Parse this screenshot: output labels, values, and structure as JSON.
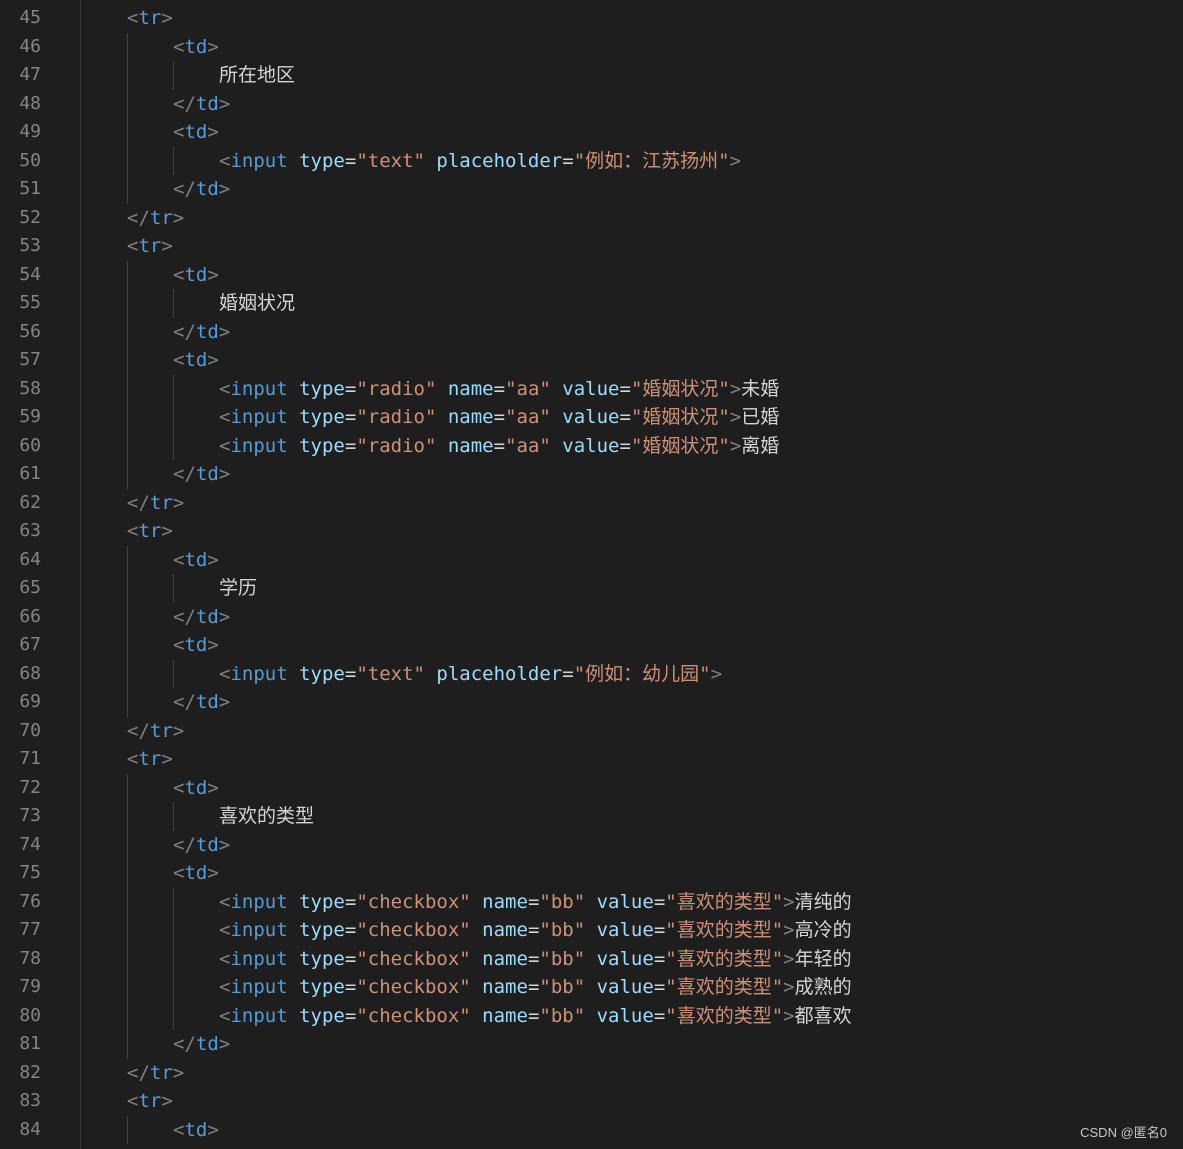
{
  "editor": {
    "lines": [
      {
        "num": "45",
        "indent": 1,
        "tokens": [
          [
            "t-punct",
            "<"
          ],
          [
            "t-tag",
            "tr"
          ],
          [
            "t-punct",
            ">"
          ]
        ]
      },
      {
        "num": "46",
        "indent": 2,
        "tokens": [
          [
            "t-punct",
            "<"
          ],
          [
            "t-tag",
            "td"
          ],
          [
            "t-punct",
            ">"
          ]
        ]
      },
      {
        "num": "47",
        "indent": 3,
        "tokens": [
          [
            "t-text",
            "所在地区"
          ]
        ]
      },
      {
        "num": "48",
        "indent": 2,
        "tokens": [
          [
            "t-punct",
            "</"
          ],
          [
            "t-tag",
            "td"
          ],
          [
            "t-punct",
            ">"
          ]
        ]
      },
      {
        "num": "49",
        "indent": 2,
        "tokens": [
          [
            "t-punct",
            "<"
          ],
          [
            "t-tag",
            "td"
          ],
          [
            "t-punct",
            ">"
          ]
        ]
      },
      {
        "num": "50",
        "indent": 3,
        "tokens": [
          [
            "t-punct",
            "<"
          ],
          [
            "t-tag",
            "input"
          ],
          [
            "t-text",
            " "
          ],
          [
            "t-attr",
            "type"
          ],
          [
            "t-eq",
            "="
          ],
          [
            "t-str",
            "\"text\""
          ],
          [
            "t-text",
            " "
          ],
          [
            "t-attr",
            "placeholder"
          ],
          [
            "t-eq",
            "="
          ],
          [
            "t-str",
            "\"例如：江苏扬州\""
          ],
          [
            "t-punct",
            ">"
          ]
        ]
      },
      {
        "num": "51",
        "indent": 2,
        "tokens": [
          [
            "t-punct",
            "</"
          ],
          [
            "t-tag",
            "td"
          ],
          [
            "t-punct",
            ">"
          ]
        ]
      },
      {
        "num": "52",
        "indent": 1,
        "tokens": [
          [
            "t-punct",
            "</"
          ],
          [
            "t-tag",
            "tr"
          ],
          [
            "t-punct",
            ">"
          ]
        ]
      },
      {
        "num": "53",
        "indent": 1,
        "tokens": [
          [
            "t-punct",
            "<"
          ],
          [
            "t-tag",
            "tr"
          ],
          [
            "t-punct",
            ">"
          ]
        ]
      },
      {
        "num": "54",
        "indent": 2,
        "tokens": [
          [
            "t-punct",
            "<"
          ],
          [
            "t-tag",
            "td"
          ],
          [
            "t-punct",
            ">"
          ]
        ]
      },
      {
        "num": "55",
        "indent": 3,
        "tokens": [
          [
            "t-text",
            "婚姻状况"
          ]
        ]
      },
      {
        "num": "56",
        "indent": 2,
        "tokens": [
          [
            "t-punct",
            "</"
          ],
          [
            "t-tag",
            "td"
          ],
          [
            "t-punct",
            ">"
          ]
        ]
      },
      {
        "num": "57",
        "indent": 2,
        "tokens": [
          [
            "t-punct",
            "<"
          ],
          [
            "t-tag",
            "td"
          ],
          [
            "t-punct",
            ">"
          ]
        ]
      },
      {
        "num": "58",
        "indent": 3,
        "tokens": [
          [
            "t-punct",
            "<"
          ],
          [
            "t-tag",
            "input"
          ],
          [
            "t-text",
            " "
          ],
          [
            "t-attr",
            "type"
          ],
          [
            "t-eq",
            "="
          ],
          [
            "t-str",
            "\"radio\""
          ],
          [
            "t-text",
            " "
          ],
          [
            "t-attr",
            "name"
          ],
          [
            "t-eq",
            "="
          ],
          [
            "t-str",
            "\"aa\""
          ],
          [
            "t-text",
            " "
          ],
          [
            "t-attr",
            "value"
          ],
          [
            "t-eq",
            "="
          ],
          [
            "t-str",
            "\"婚姻状况\""
          ],
          [
            "t-punct",
            ">"
          ],
          [
            "t-text",
            "未婚"
          ]
        ]
      },
      {
        "num": "59",
        "indent": 3,
        "tokens": [
          [
            "t-punct",
            "<"
          ],
          [
            "t-tag",
            "input"
          ],
          [
            "t-text",
            " "
          ],
          [
            "t-attr",
            "type"
          ],
          [
            "t-eq",
            "="
          ],
          [
            "t-str",
            "\"radio\""
          ],
          [
            "t-text",
            " "
          ],
          [
            "t-attr",
            "name"
          ],
          [
            "t-eq",
            "="
          ],
          [
            "t-str",
            "\"aa\""
          ],
          [
            "t-text",
            " "
          ],
          [
            "t-attr",
            "value"
          ],
          [
            "t-eq",
            "="
          ],
          [
            "t-str",
            "\"婚姻状况\""
          ],
          [
            "t-punct",
            ">"
          ],
          [
            "t-text",
            "已婚"
          ]
        ]
      },
      {
        "num": "60",
        "indent": 3,
        "tokens": [
          [
            "t-punct",
            "<"
          ],
          [
            "t-tag",
            "input"
          ],
          [
            "t-text",
            " "
          ],
          [
            "t-attr",
            "type"
          ],
          [
            "t-eq",
            "="
          ],
          [
            "t-str",
            "\"radio\""
          ],
          [
            "t-text",
            " "
          ],
          [
            "t-attr",
            "name"
          ],
          [
            "t-eq",
            "="
          ],
          [
            "t-str",
            "\"aa\""
          ],
          [
            "t-text",
            " "
          ],
          [
            "t-attr",
            "value"
          ],
          [
            "t-eq",
            "="
          ],
          [
            "t-str",
            "\"婚姻状况\""
          ],
          [
            "t-punct",
            ">"
          ],
          [
            "t-text",
            "离婚"
          ]
        ]
      },
      {
        "num": "61",
        "indent": 2,
        "tokens": [
          [
            "t-punct",
            "</"
          ],
          [
            "t-tag",
            "td"
          ],
          [
            "t-punct",
            ">"
          ]
        ]
      },
      {
        "num": "62",
        "indent": 1,
        "tokens": [
          [
            "t-punct",
            "</"
          ],
          [
            "t-tag",
            "tr"
          ],
          [
            "t-punct",
            ">"
          ]
        ]
      },
      {
        "num": "63",
        "indent": 1,
        "tokens": [
          [
            "t-punct",
            "<"
          ],
          [
            "t-tag",
            "tr"
          ],
          [
            "t-punct",
            ">"
          ]
        ]
      },
      {
        "num": "64",
        "indent": 2,
        "tokens": [
          [
            "t-punct",
            "<"
          ],
          [
            "t-tag",
            "td"
          ],
          [
            "t-punct",
            ">"
          ]
        ]
      },
      {
        "num": "65",
        "indent": 3,
        "tokens": [
          [
            "t-text",
            "学历"
          ]
        ]
      },
      {
        "num": "66",
        "indent": 2,
        "tokens": [
          [
            "t-punct",
            "</"
          ],
          [
            "t-tag",
            "td"
          ],
          [
            "t-punct",
            ">"
          ]
        ]
      },
      {
        "num": "67",
        "indent": 2,
        "tokens": [
          [
            "t-punct",
            "<"
          ],
          [
            "t-tag",
            "td"
          ],
          [
            "t-punct",
            ">"
          ]
        ]
      },
      {
        "num": "68",
        "indent": 3,
        "tokens": [
          [
            "t-punct",
            "<"
          ],
          [
            "t-tag",
            "input"
          ],
          [
            "t-text",
            " "
          ],
          [
            "t-attr",
            "type"
          ],
          [
            "t-eq",
            "="
          ],
          [
            "t-str",
            "\"text\""
          ],
          [
            "t-text",
            " "
          ],
          [
            "t-attr",
            "placeholder"
          ],
          [
            "t-eq",
            "="
          ],
          [
            "t-str",
            "\"例如：幼儿园\""
          ],
          [
            "t-punct",
            ">"
          ]
        ]
      },
      {
        "num": "69",
        "indent": 2,
        "tokens": [
          [
            "t-punct",
            "</"
          ],
          [
            "t-tag",
            "td"
          ],
          [
            "t-punct",
            ">"
          ]
        ]
      },
      {
        "num": "70",
        "indent": 1,
        "tokens": [
          [
            "t-punct",
            "</"
          ],
          [
            "t-tag",
            "tr"
          ],
          [
            "t-punct",
            ">"
          ]
        ]
      },
      {
        "num": "71",
        "indent": 1,
        "tokens": [
          [
            "t-punct",
            "<"
          ],
          [
            "t-tag",
            "tr"
          ],
          [
            "t-punct",
            ">"
          ]
        ]
      },
      {
        "num": "72",
        "indent": 2,
        "tokens": [
          [
            "t-punct",
            "<"
          ],
          [
            "t-tag",
            "td"
          ],
          [
            "t-punct",
            ">"
          ]
        ]
      },
      {
        "num": "73",
        "indent": 3,
        "tokens": [
          [
            "t-text",
            "喜欢的类型"
          ]
        ]
      },
      {
        "num": "74",
        "indent": 2,
        "tokens": [
          [
            "t-punct",
            "</"
          ],
          [
            "t-tag",
            "td"
          ],
          [
            "t-punct",
            ">"
          ]
        ]
      },
      {
        "num": "75",
        "indent": 2,
        "tokens": [
          [
            "t-punct",
            "<"
          ],
          [
            "t-tag",
            "td"
          ],
          [
            "t-punct",
            ">"
          ]
        ]
      },
      {
        "num": "76",
        "indent": 3,
        "tokens": [
          [
            "t-punct",
            "<"
          ],
          [
            "t-tag",
            "input"
          ],
          [
            "t-text",
            " "
          ],
          [
            "t-attr",
            "type"
          ],
          [
            "t-eq",
            "="
          ],
          [
            "t-str",
            "\"checkbox\""
          ],
          [
            "t-text",
            " "
          ],
          [
            "t-attr",
            "name"
          ],
          [
            "t-eq",
            "="
          ],
          [
            "t-str",
            "\"bb\""
          ],
          [
            "t-text",
            " "
          ],
          [
            "t-attr",
            "value"
          ],
          [
            "t-eq",
            "="
          ],
          [
            "t-str",
            "\"喜欢的类型\""
          ],
          [
            "t-punct",
            ">"
          ],
          [
            "t-text",
            "清纯的"
          ]
        ]
      },
      {
        "num": "77",
        "indent": 3,
        "tokens": [
          [
            "t-punct",
            "<"
          ],
          [
            "t-tag",
            "input"
          ],
          [
            "t-text",
            " "
          ],
          [
            "t-attr",
            "type"
          ],
          [
            "t-eq",
            "="
          ],
          [
            "t-str",
            "\"checkbox\""
          ],
          [
            "t-text",
            " "
          ],
          [
            "t-attr",
            "name"
          ],
          [
            "t-eq",
            "="
          ],
          [
            "t-str",
            "\"bb\""
          ],
          [
            "t-text",
            " "
          ],
          [
            "t-attr",
            "value"
          ],
          [
            "t-eq",
            "="
          ],
          [
            "t-str",
            "\"喜欢的类型\""
          ],
          [
            "t-punct",
            ">"
          ],
          [
            "t-text",
            "高冷的"
          ]
        ]
      },
      {
        "num": "78",
        "indent": 3,
        "tokens": [
          [
            "t-punct",
            "<"
          ],
          [
            "t-tag",
            "input"
          ],
          [
            "t-text",
            " "
          ],
          [
            "t-attr",
            "type"
          ],
          [
            "t-eq",
            "="
          ],
          [
            "t-str",
            "\"checkbox\""
          ],
          [
            "t-text",
            " "
          ],
          [
            "t-attr",
            "name"
          ],
          [
            "t-eq",
            "="
          ],
          [
            "t-str",
            "\"bb\""
          ],
          [
            "t-text",
            " "
          ],
          [
            "t-attr",
            "value"
          ],
          [
            "t-eq",
            "="
          ],
          [
            "t-str",
            "\"喜欢的类型\""
          ],
          [
            "t-punct",
            ">"
          ],
          [
            "t-text",
            "年轻的"
          ]
        ]
      },
      {
        "num": "79",
        "indent": 3,
        "tokens": [
          [
            "t-punct",
            "<"
          ],
          [
            "t-tag",
            "input"
          ],
          [
            "t-text",
            " "
          ],
          [
            "t-attr",
            "type"
          ],
          [
            "t-eq",
            "="
          ],
          [
            "t-str",
            "\"checkbox\""
          ],
          [
            "t-text",
            " "
          ],
          [
            "t-attr",
            "name"
          ],
          [
            "t-eq",
            "="
          ],
          [
            "t-str",
            "\"bb\""
          ],
          [
            "t-text",
            " "
          ],
          [
            "t-attr",
            "value"
          ],
          [
            "t-eq",
            "="
          ],
          [
            "t-str",
            "\"喜欢的类型\""
          ],
          [
            "t-punct",
            ">"
          ],
          [
            "t-text",
            "成熟的"
          ]
        ]
      },
      {
        "num": "80",
        "indent": 3,
        "tokens": [
          [
            "t-punct",
            "<"
          ],
          [
            "t-tag",
            "input"
          ],
          [
            "t-text",
            " "
          ],
          [
            "t-attr",
            "type"
          ],
          [
            "t-eq",
            "="
          ],
          [
            "t-str",
            "\"checkbox\""
          ],
          [
            "t-text",
            " "
          ],
          [
            "t-attr",
            "name"
          ],
          [
            "t-eq",
            "="
          ],
          [
            "t-str",
            "\"bb\""
          ],
          [
            "t-text",
            " "
          ],
          [
            "t-attr",
            "value"
          ],
          [
            "t-eq",
            "="
          ],
          [
            "t-str",
            "\"喜欢的类型\""
          ],
          [
            "t-punct",
            ">"
          ],
          [
            "t-text",
            "都喜欢"
          ]
        ]
      },
      {
        "num": "81",
        "indent": 2,
        "tokens": [
          [
            "t-punct",
            "</"
          ],
          [
            "t-tag",
            "td"
          ],
          [
            "t-punct",
            ">"
          ]
        ]
      },
      {
        "num": "82",
        "indent": 1,
        "tokens": [
          [
            "t-punct",
            "</"
          ],
          [
            "t-tag",
            "tr"
          ],
          [
            "t-punct",
            ">"
          ]
        ]
      },
      {
        "num": "83",
        "indent": 1,
        "tokens": [
          [
            "t-punct",
            "<"
          ],
          [
            "t-tag",
            "tr"
          ],
          [
            "t-punct",
            ">"
          ]
        ]
      },
      {
        "num": "84",
        "indent": 2,
        "tokens": [
          [
            "t-punct",
            "<"
          ],
          [
            "t-tag",
            "td"
          ],
          [
            "t-punct",
            ">"
          ]
        ]
      }
    ]
  },
  "watermark": "CSDN @匿名0",
  "colors": {
    "background": "#1e1e1e",
    "line_number": "#858585",
    "punctuation": "#808080",
    "tag": "#569cd6",
    "attribute": "#9cdcfe",
    "string": "#ce9178",
    "text": "#d4d4d4"
  }
}
